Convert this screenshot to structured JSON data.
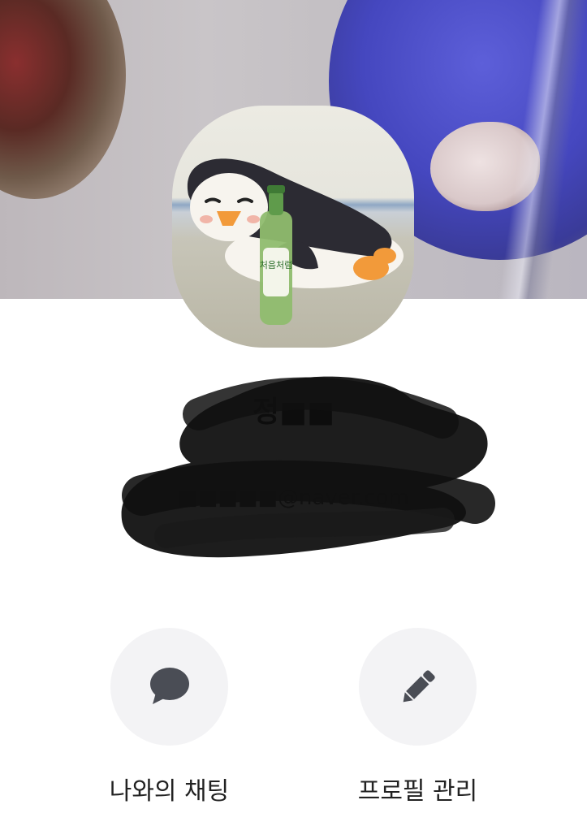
{
  "profile": {
    "name": "정■■",
    "email": "■■■■■@naver.com"
  },
  "actions": [
    {
      "label": "나와의 채팅",
      "icon": "chat-bubble-icon"
    },
    {
      "label": "프로필 관리",
      "icon": "pencil-icon"
    }
  ],
  "avatar_bottle_text": "처음처럼",
  "colors": {
    "icon": "#4a4d55",
    "action_bg": "#f3f3f5",
    "text": "#222222"
  }
}
